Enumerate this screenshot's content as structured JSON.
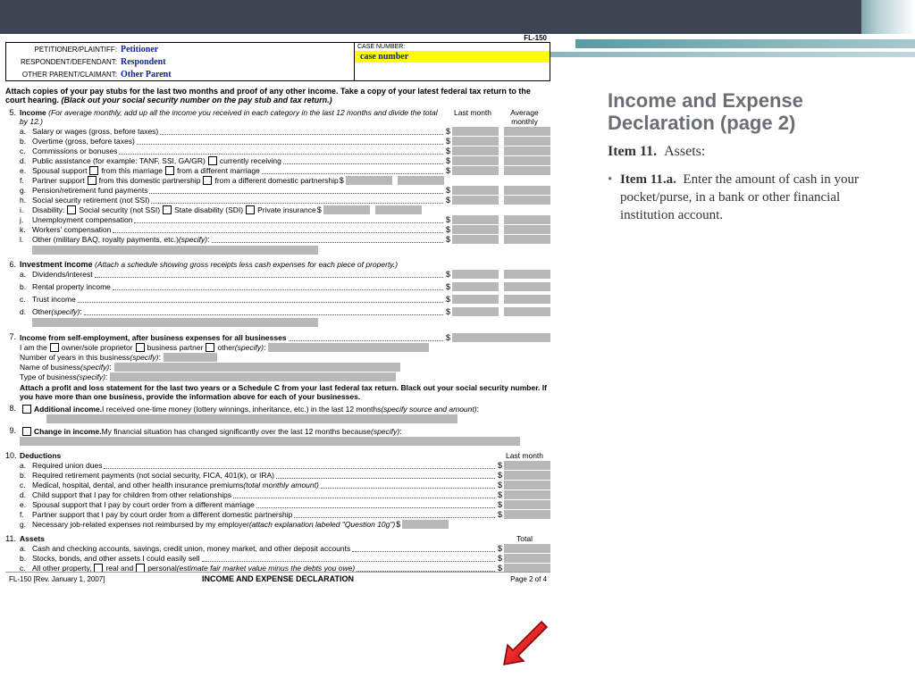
{
  "formCode": "FL-150",
  "header": {
    "petitioner_label": "PETITIONER/PLAINTIFF:",
    "petitioner": "Petitioner",
    "respondent_label": "RESPONDENT/DEFENDANT:",
    "respondent": "Respondent",
    "other_label": "OTHER PARENT/CLAIMANT:",
    "other": "Other Parent",
    "case_label": "CASE NUMBER:",
    "case": "case number"
  },
  "attach": {
    "bold": "Attach copies of your pay stubs for the last two months and proof of any other income. Take a copy of your latest federal tax return to the court hearing.",
    "ital": "(Black out your social security number on the pay stub and tax return.)"
  },
  "cols": {
    "c1": "Last month",
    "c2a": "Average",
    "c2b": "monthly"
  },
  "i5": {
    "title": "Income",
    "note": "(For average monthly, add up all the income you received in each category in the last 12 months and divide the total by 12.)",
    "a": "Salary or wages (gross, before taxes)",
    "b": "Overtime (gross, before taxes)",
    "c": "Commissions or bonuses",
    "d": "Public assistance (for example: TANF, SSI, GA/GR)",
    "d2": "currently receiving",
    "e": "Spousal support",
    "e1": "from this marriage",
    "e2": "from a different marriage",
    "f": "Partner support",
    "f1": "from this domestic partnership",
    "f2": "from a different domestic partnership",
    "g": "Pension/retirement fund payments",
    "h": "Social security retirement (not SSI)",
    "i": "Disability:",
    "i1": "Social security (not SSI)",
    "i2": "State disability (SDI)",
    "i3": "Private insurance",
    "j": "Unemployment compensation",
    "k": "Workers' compensation",
    "l": "Other (military BAQ, royalty payments, etc.)",
    "spec": "(specify)"
  },
  "i6": {
    "title": "Investment income",
    "note": "(Attach a schedule showing gross receipts less cash expenses for each piece of property.)",
    "a": "Dividends/interest",
    "b": "Rental property income",
    "c": "Trust income",
    "d": "Other",
    "spec": "(specify)"
  },
  "i7": {
    "title": "Income from self-employment, after business expenses for all businesses",
    "iam": "I am the",
    "o1": "owner/sole proprietor",
    "o2": "business partner",
    "o3": "other",
    "spec": "(specify)",
    "yrs": "Number of years in this business",
    "name": "Name of business",
    "type": "Type of business",
    "att": "Attach a profit and loss statement for the last two years or a Schedule C from your last federal tax return. Black out your social security number. If you have more than one business, provide the information above for each of your businesses."
  },
  "i8": {
    "title": "Additional income.",
    "text": "I received one-time money (lottery winnings, inheritance, etc.) in the last 12 months",
    "spec": "(specify source and amount)"
  },
  "i9": {
    "title": "Change in income.",
    "text": "My financial situation has changed significantly over the last 12 months because",
    "spec": "(specify)"
  },
  "i10": {
    "title": "Deductions",
    "col": "Last month",
    "a": "Required union dues",
    "b": "Required retirement payments (not social security, FICA, 401(k), or IRA)",
    "c": "Medical, hospital, dental, and other health insurance premiums",
    "c2": "(total monthly amount)",
    "d": "Child support that I pay for children from other relationships",
    "e": "Spousal support that I pay by court order from a different marriage",
    "f": "Partner support that I pay by court order from a different domestic partnership",
    "g": "Necessary job-related expenses not reimbursed by my employer",
    "g2": "(attach explanation labeled \"Question 10g\")"
  },
  "i11": {
    "title": "Assets",
    "col": "Total",
    "a": "Cash and checking accounts, savings, credit union, money market, and other deposit accounts",
    "b": "Stocks, bonds, and other assets I could easily sell",
    "c": "All other property,",
    "c1": "real and",
    "c2": "personal",
    "c3": "(estimate fair market value minus the debts you owe)"
  },
  "footer": {
    "left": "FL-150 [Rev. January 1, 2007]",
    "center": "INCOME AND EXPENSE DECLARATION",
    "right": "Page 2 of 4"
  },
  "instr": {
    "title": "Income and Expense Declaration (page 2)",
    "sub_b": "Item 11.",
    "sub_t": "Assets:",
    "li_b": "Item 11.a.",
    "li_t": "Enter the amount of cash in your pocket/purse, in a bank or other financial institution account."
  }
}
